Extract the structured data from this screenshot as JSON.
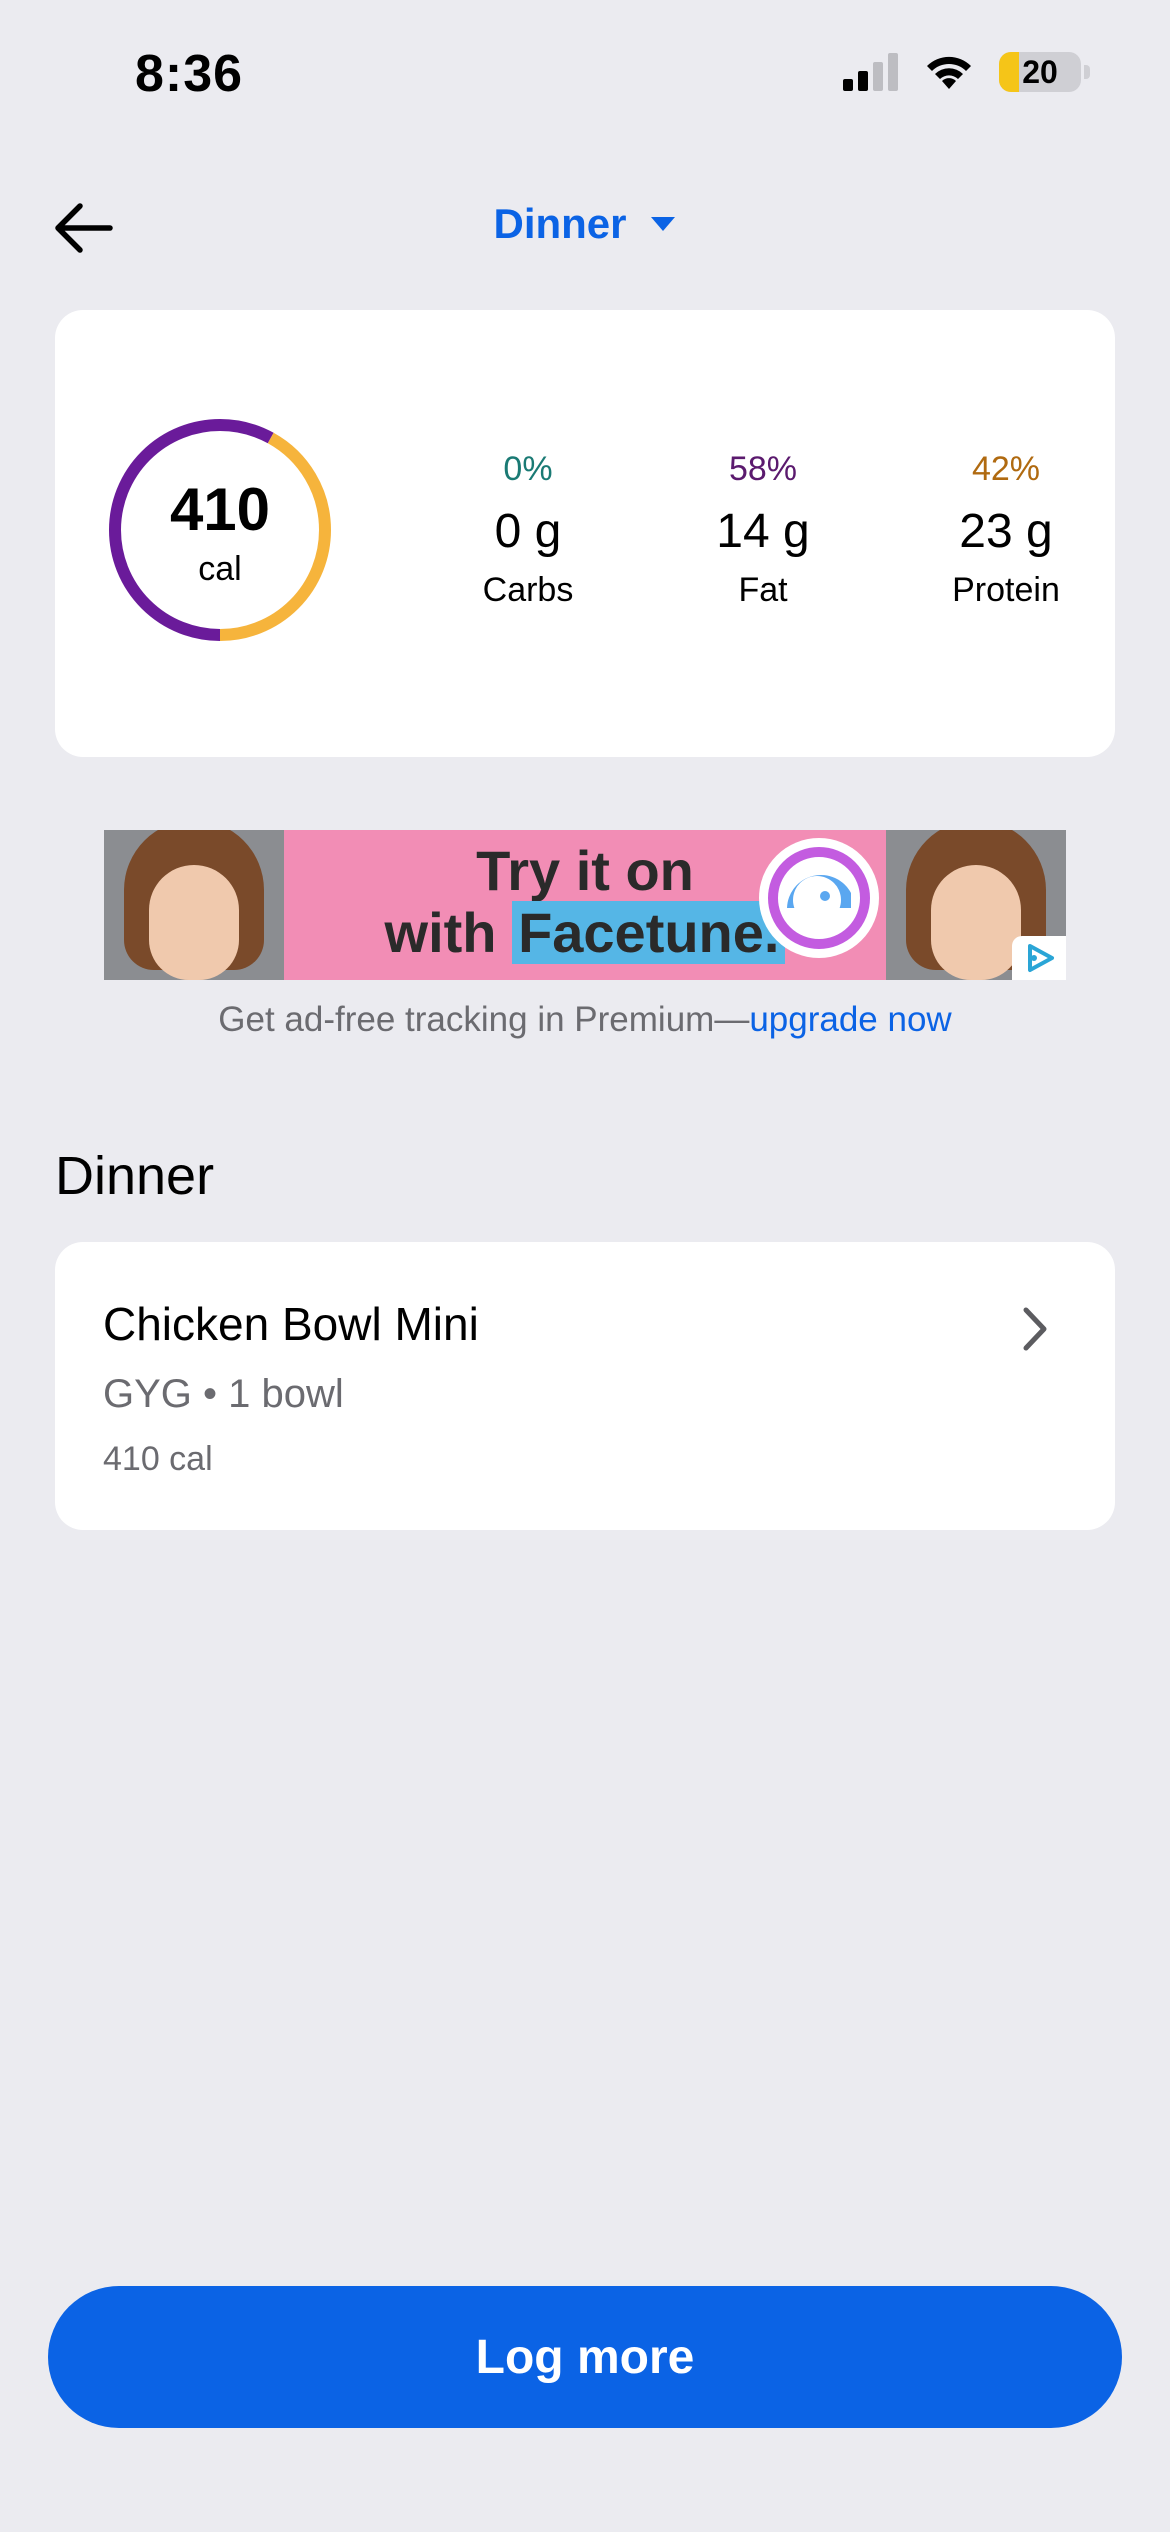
{
  "status_bar": {
    "time": "8:36",
    "battery_level": "20",
    "icons": [
      "cellular-signal-icon",
      "wifi-icon",
      "battery-icon"
    ]
  },
  "header": {
    "back_icon": "arrow-left-icon",
    "meal_label": "Dinner",
    "dropdown_icon": "caret-down-icon",
    "accent_color": "#0b63e5"
  },
  "summary": {
    "calories": "410",
    "calories_unit": "cal",
    "ring": {
      "fat_share": 0.58,
      "protein_share": 0.42,
      "fat_color": "#6a1b9a",
      "protein_color": "#f6b43c"
    },
    "macros": [
      {
        "pct": "0%",
        "grams": "0 g",
        "name": "Carbs",
        "color": "#1a7a74"
      },
      {
        "pct": "58%",
        "grams": "14 g",
        "name": "Fat",
        "color": "#5b1a6e"
      },
      {
        "pct": "42%",
        "grams": "23 g",
        "name": "Protein",
        "color": "#b06a10"
      }
    ]
  },
  "ad": {
    "line1": "Try it on",
    "line2_prefix": "with ",
    "line2_brand": "Facetune.",
    "choice_icon": "ad-choices-icon"
  },
  "premium": {
    "text": "Get ad-free tracking in Premium—",
    "link": "upgrade now"
  },
  "section": {
    "title": "Dinner"
  },
  "food_items": [
    {
      "name": "Chicken Bowl Mini",
      "meta": "GYG • 1 bowl",
      "calories": "410 cal",
      "icon": "chevron-right-icon"
    }
  ],
  "footer": {
    "button_label": "Log more",
    "button_color": "#0b63e5"
  }
}
